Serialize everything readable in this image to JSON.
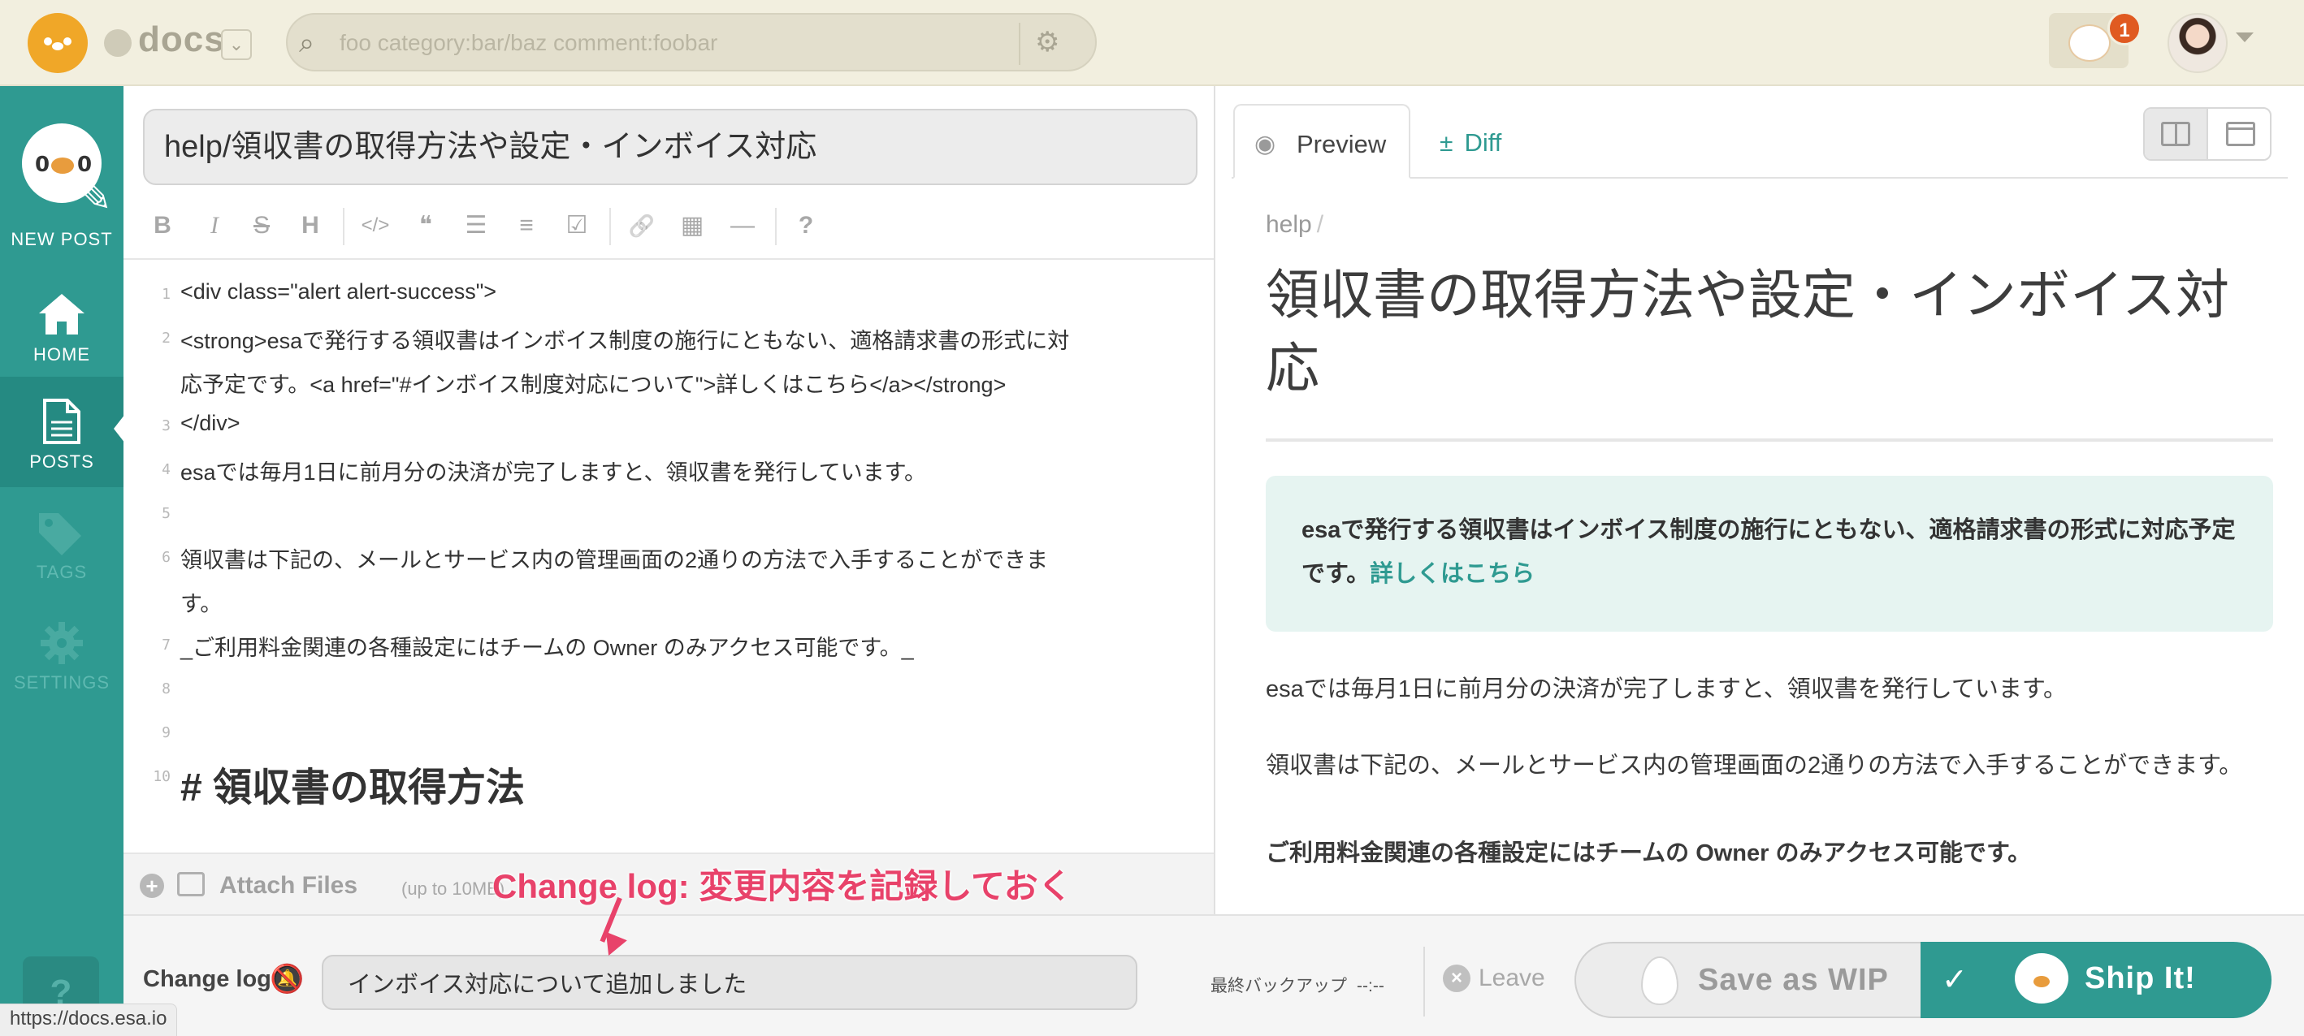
{
  "header": {
    "team_name": "docs",
    "search_placeholder": "foo category:bar/baz comment:foobar",
    "notification_count": "1"
  },
  "sidebar": {
    "new_post": "NEW POST",
    "items": [
      {
        "label": "HOME",
        "icon": "home-icon"
      },
      {
        "label": "POSTS",
        "icon": "document-icon"
      },
      {
        "label": "TAGS",
        "icon": "tag-icon"
      },
      {
        "label": "SETTINGS",
        "icon": "gear-icon"
      }
    ],
    "help": "?"
  },
  "editor": {
    "title": "help/領収書の取得方法や設定・インボイス対応",
    "toolbar": [
      "B",
      "I",
      "S",
      "H",
      "</>",
      "❝",
      "☰",
      "≡",
      "☑",
      "🔗",
      "▦",
      "—",
      "?"
    ],
    "lines": [
      {
        "num": "1",
        "text": "<div class=\"alert alert-success\">"
      },
      {
        "num": "2",
        "text": "<strong>esaで発行する領収書はインボイス制度の施行にともない、適格請求書の形式に対"
      },
      {
        "num": "",
        "text": "応予定です。<a href=\"#インボイス制度対応について\">詳しくはこちら</a></strong>"
      },
      {
        "num": "3",
        "text": "</div>"
      },
      {
        "num": "4",
        "text": "esaでは毎月1日に前月分の決済が完了しますと、領収書を発行しています。"
      },
      {
        "num": "5",
        "text": ""
      },
      {
        "num": "6",
        "text": "領収書は下記の、メールとサービス内の管理画面の2通りの方法で入手することができま"
      },
      {
        "num": "",
        "text": "す。"
      },
      {
        "num": "7",
        "text": "_ご利用料金関連の各種設定にはチームの Owner のみアクセス可能です。_"
      },
      {
        "num": "8",
        "text": ""
      },
      {
        "num": "9",
        "text": ""
      },
      {
        "num": "10",
        "text": "# 領収書の取得方法"
      }
    ],
    "attach_label": "Attach Files",
    "attach_size": "(up to 10MB)",
    "annotation": "Change log: 変更内容を記録しておく"
  },
  "preview": {
    "tab_preview": "Preview",
    "tab_diff": "Diff",
    "breadcrumb": "help",
    "breadcrumb_sep": "/",
    "title": "領収書の取得方法や設定・インボイス対応",
    "alert_text": "esaで発行する領収書はインボイス制度の施行にともない、適格請求書の形式に対応予定です。",
    "alert_link": "詳しくはこちら",
    "para1": "esaでは毎月1日に前月分の決済が完了しますと、領収書を発行しています。",
    "para2": "領収書は下記の、メールとサービス内の管理画面の2通りの方法で入手することができます。",
    "para3": "ご利用料金関連の各種設定にはチームの Owner のみアクセス可能です。"
  },
  "bottombar": {
    "changelog_label": "Change log",
    "changelog_value": "インボイス対応について追加しました",
    "backup_label": "最終バックアップ",
    "backup_value": "--:--",
    "leave_label": "Leave",
    "wip_label": "Save as WIP",
    "ship_label": "Ship It!"
  },
  "status_url": "https://docs.esa.io",
  "colors": {
    "accent": "#2f9a91",
    "topbar": "#f2efdf",
    "annotation": "#e8426a"
  }
}
